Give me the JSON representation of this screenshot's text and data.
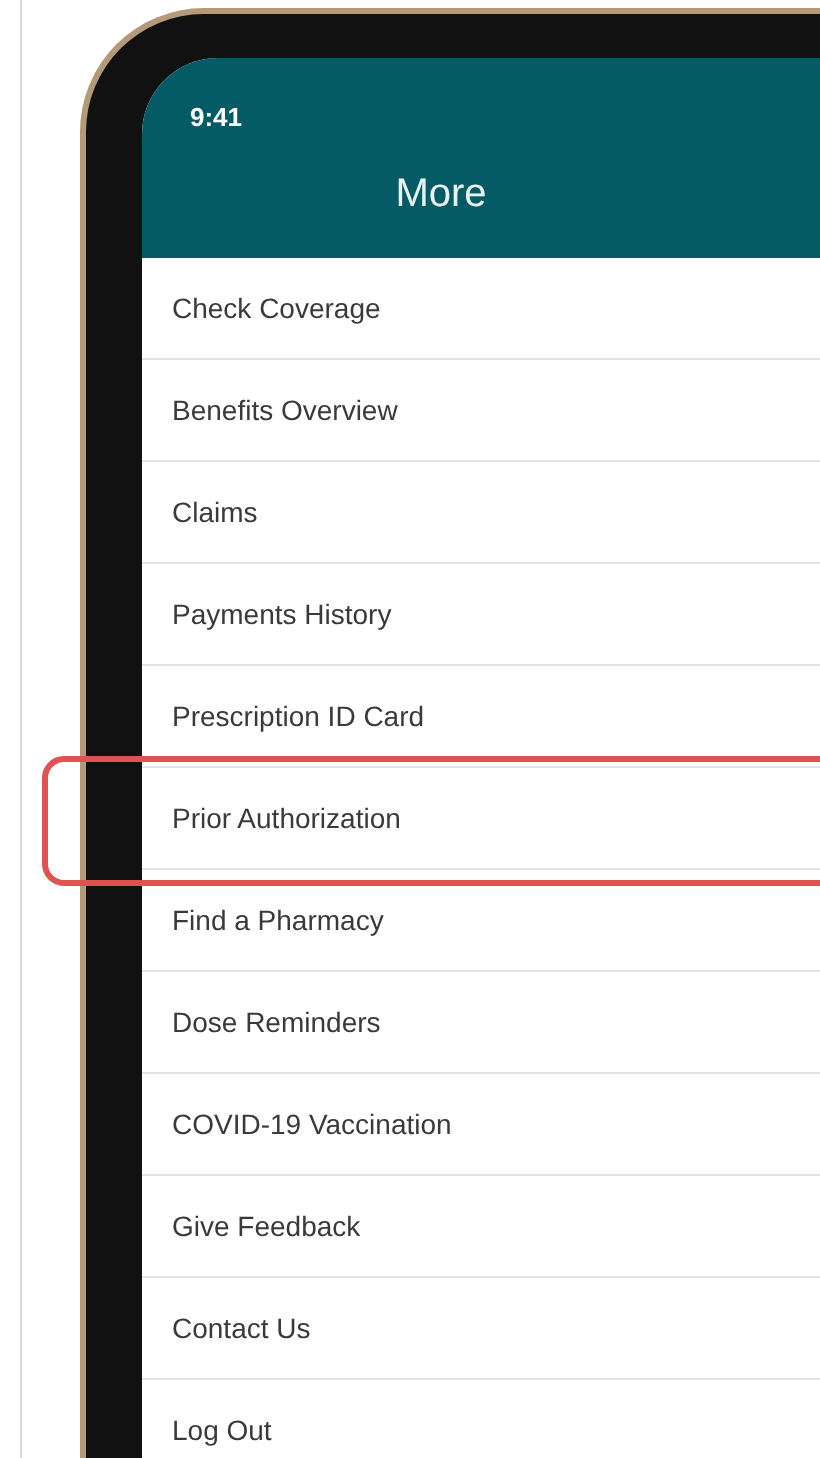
{
  "status_bar": {
    "time": "9:41"
  },
  "header": {
    "title": "More"
  },
  "menu": [
    {
      "label": "Check Coverage",
      "highlighted": false
    },
    {
      "label": "Benefits Overview",
      "highlighted": false
    },
    {
      "label": "Claims",
      "highlighted": false
    },
    {
      "label": "Payments History",
      "highlighted": false
    },
    {
      "label": "Prescription ID Card",
      "highlighted": false
    },
    {
      "label": "Prior Authorization",
      "highlighted": true
    },
    {
      "label": "Find a Pharmacy",
      "highlighted": false
    },
    {
      "label": "Dose Reminders",
      "highlighted": false
    },
    {
      "label": "COVID-19 Vaccination",
      "highlighted": false
    },
    {
      "label": "Give Feedback",
      "highlighted": false
    },
    {
      "label": "Contact Us",
      "highlighted": false
    },
    {
      "label": "Log Out",
      "highlighted": false
    }
  ]
}
